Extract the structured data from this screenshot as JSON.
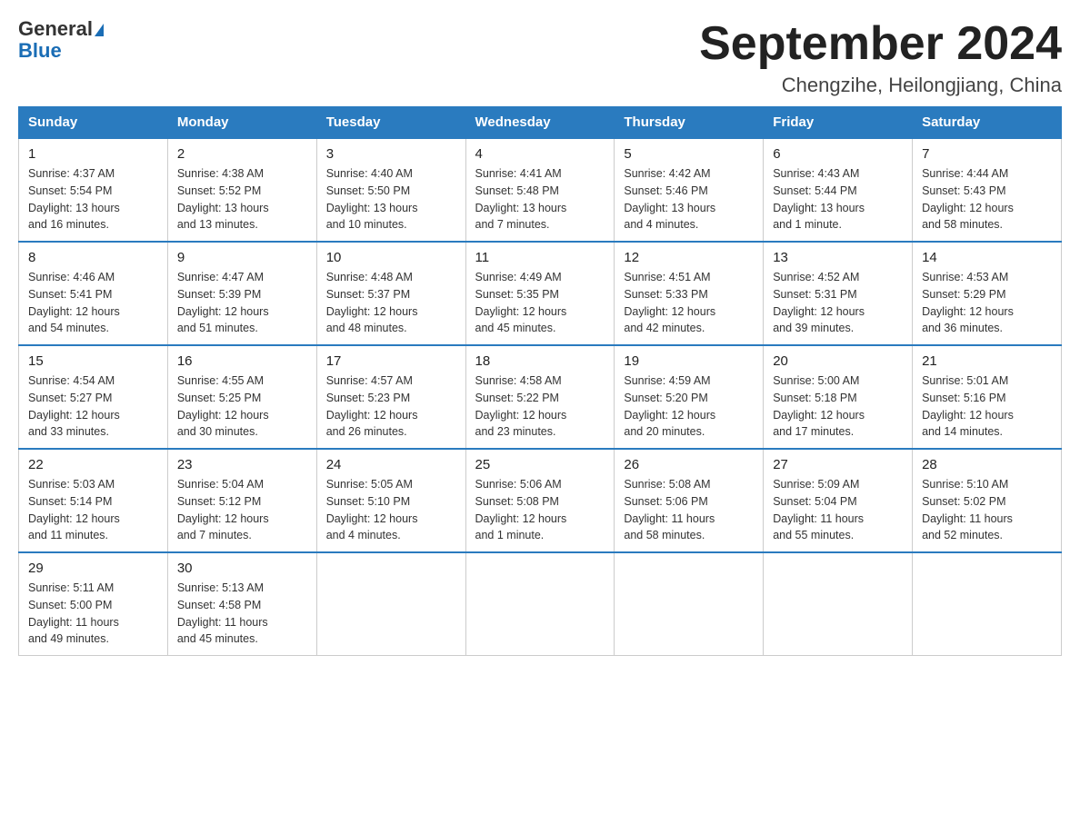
{
  "header": {
    "logo_general": "General",
    "logo_blue": "Blue",
    "month_title": "September 2024",
    "subtitle": "Chengzihe, Heilongjiang, China"
  },
  "days_of_week": [
    "Sunday",
    "Monday",
    "Tuesday",
    "Wednesday",
    "Thursday",
    "Friday",
    "Saturday"
  ],
  "weeks": [
    [
      {
        "day": "1",
        "sunrise": "4:37 AM",
        "sunset": "5:54 PM",
        "daylight": "13 hours and 16 minutes."
      },
      {
        "day": "2",
        "sunrise": "4:38 AM",
        "sunset": "5:52 PM",
        "daylight": "13 hours and 13 minutes."
      },
      {
        "day": "3",
        "sunrise": "4:40 AM",
        "sunset": "5:50 PM",
        "daylight": "13 hours and 10 minutes."
      },
      {
        "day": "4",
        "sunrise": "4:41 AM",
        "sunset": "5:48 PM",
        "daylight": "13 hours and 7 minutes."
      },
      {
        "day": "5",
        "sunrise": "4:42 AM",
        "sunset": "5:46 PM",
        "daylight": "13 hours and 4 minutes."
      },
      {
        "day": "6",
        "sunrise": "4:43 AM",
        "sunset": "5:44 PM",
        "daylight": "13 hours and 1 minute."
      },
      {
        "day": "7",
        "sunrise": "4:44 AM",
        "sunset": "5:43 PM",
        "daylight": "12 hours and 58 minutes."
      }
    ],
    [
      {
        "day": "8",
        "sunrise": "4:46 AM",
        "sunset": "5:41 PM",
        "daylight": "12 hours and 54 minutes."
      },
      {
        "day": "9",
        "sunrise": "4:47 AM",
        "sunset": "5:39 PM",
        "daylight": "12 hours and 51 minutes."
      },
      {
        "day": "10",
        "sunrise": "4:48 AM",
        "sunset": "5:37 PM",
        "daylight": "12 hours and 48 minutes."
      },
      {
        "day": "11",
        "sunrise": "4:49 AM",
        "sunset": "5:35 PM",
        "daylight": "12 hours and 45 minutes."
      },
      {
        "day": "12",
        "sunrise": "4:51 AM",
        "sunset": "5:33 PM",
        "daylight": "12 hours and 42 minutes."
      },
      {
        "day": "13",
        "sunrise": "4:52 AM",
        "sunset": "5:31 PM",
        "daylight": "12 hours and 39 minutes."
      },
      {
        "day": "14",
        "sunrise": "4:53 AM",
        "sunset": "5:29 PM",
        "daylight": "12 hours and 36 minutes."
      }
    ],
    [
      {
        "day": "15",
        "sunrise": "4:54 AM",
        "sunset": "5:27 PM",
        "daylight": "12 hours and 33 minutes."
      },
      {
        "day": "16",
        "sunrise": "4:55 AM",
        "sunset": "5:25 PM",
        "daylight": "12 hours and 30 minutes."
      },
      {
        "day": "17",
        "sunrise": "4:57 AM",
        "sunset": "5:23 PM",
        "daylight": "12 hours and 26 minutes."
      },
      {
        "day": "18",
        "sunrise": "4:58 AM",
        "sunset": "5:22 PM",
        "daylight": "12 hours and 23 minutes."
      },
      {
        "day": "19",
        "sunrise": "4:59 AM",
        "sunset": "5:20 PM",
        "daylight": "12 hours and 20 minutes."
      },
      {
        "day": "20",
        "sunrise": "5:00 AM",
        "sunset": "5:18 PM",
        "daylight": "12 hours and 17 minutes."
      },
      {
        "day": "21",
        "sunrise": "5:01 AM",
        "sunset": "5:16 PM",
        "daylight": "12 hours and 14 minutes."
      }
    ],
    [
      {
        "day": "22",
        "sunrise": "5:03 AM",
        "sunset": "5:14 PM",
        "daylight": "12 hours and 11 minutes."
      },
      {
        "day": "23",
        "sunrise": "5:04 AM",
        "sunset": "5:12 PM",
        "daylight": "12 hours and 7 minutes."
      },
      {
        "day": "24",
        "sunrise": "5:05 AM",
        "sunset": "5:10 PM",
        "daylight": "12 hours and 4 minutes."
      },
      {
        "day": "25",
        "sunrise": "5:06 AM",
        "sunset": "5:08 PM",
        "daylight": "12 hours and 1 minute."
      },
      {
        "day": "26",
        "sunrise": "5:08 AM",
        "sunset": "5:06 PM",
        "daylight": "11 hours and 58 minutes."
      },
      {
        "day": "27",
        "sunrise": "5:09 AM",
        "sunset": "5:04 PM",
        "daylight": "11 hours and 55 minutes."
      },
      {
        "day": "28",
        "sunrise": "5:10 AM",
        "sunset": "5:02 PM",
        "daylight": "11 hours and 52 minutes."
      }
    ],
    [
      {
        "day": "29",
        "sunrise": "5:11 AM",
        "sunset": "5:00 PM",
        "daylight": "11 hours and 49 minutes."
      },
      {
        "day": "30",
        "sunrise": "5:13 AM",
        "sunset": "4:58 PM",
        "daylight": "11 hours and 45 minutes."
      },
      null,
      null,
      null,
      null,
      null
    ]
  ],
  "labels": {
    "sunrise": "Sunrise:",
    "sunset": "Sunset:",
    "daylight": "Daylight:"
  }
}
